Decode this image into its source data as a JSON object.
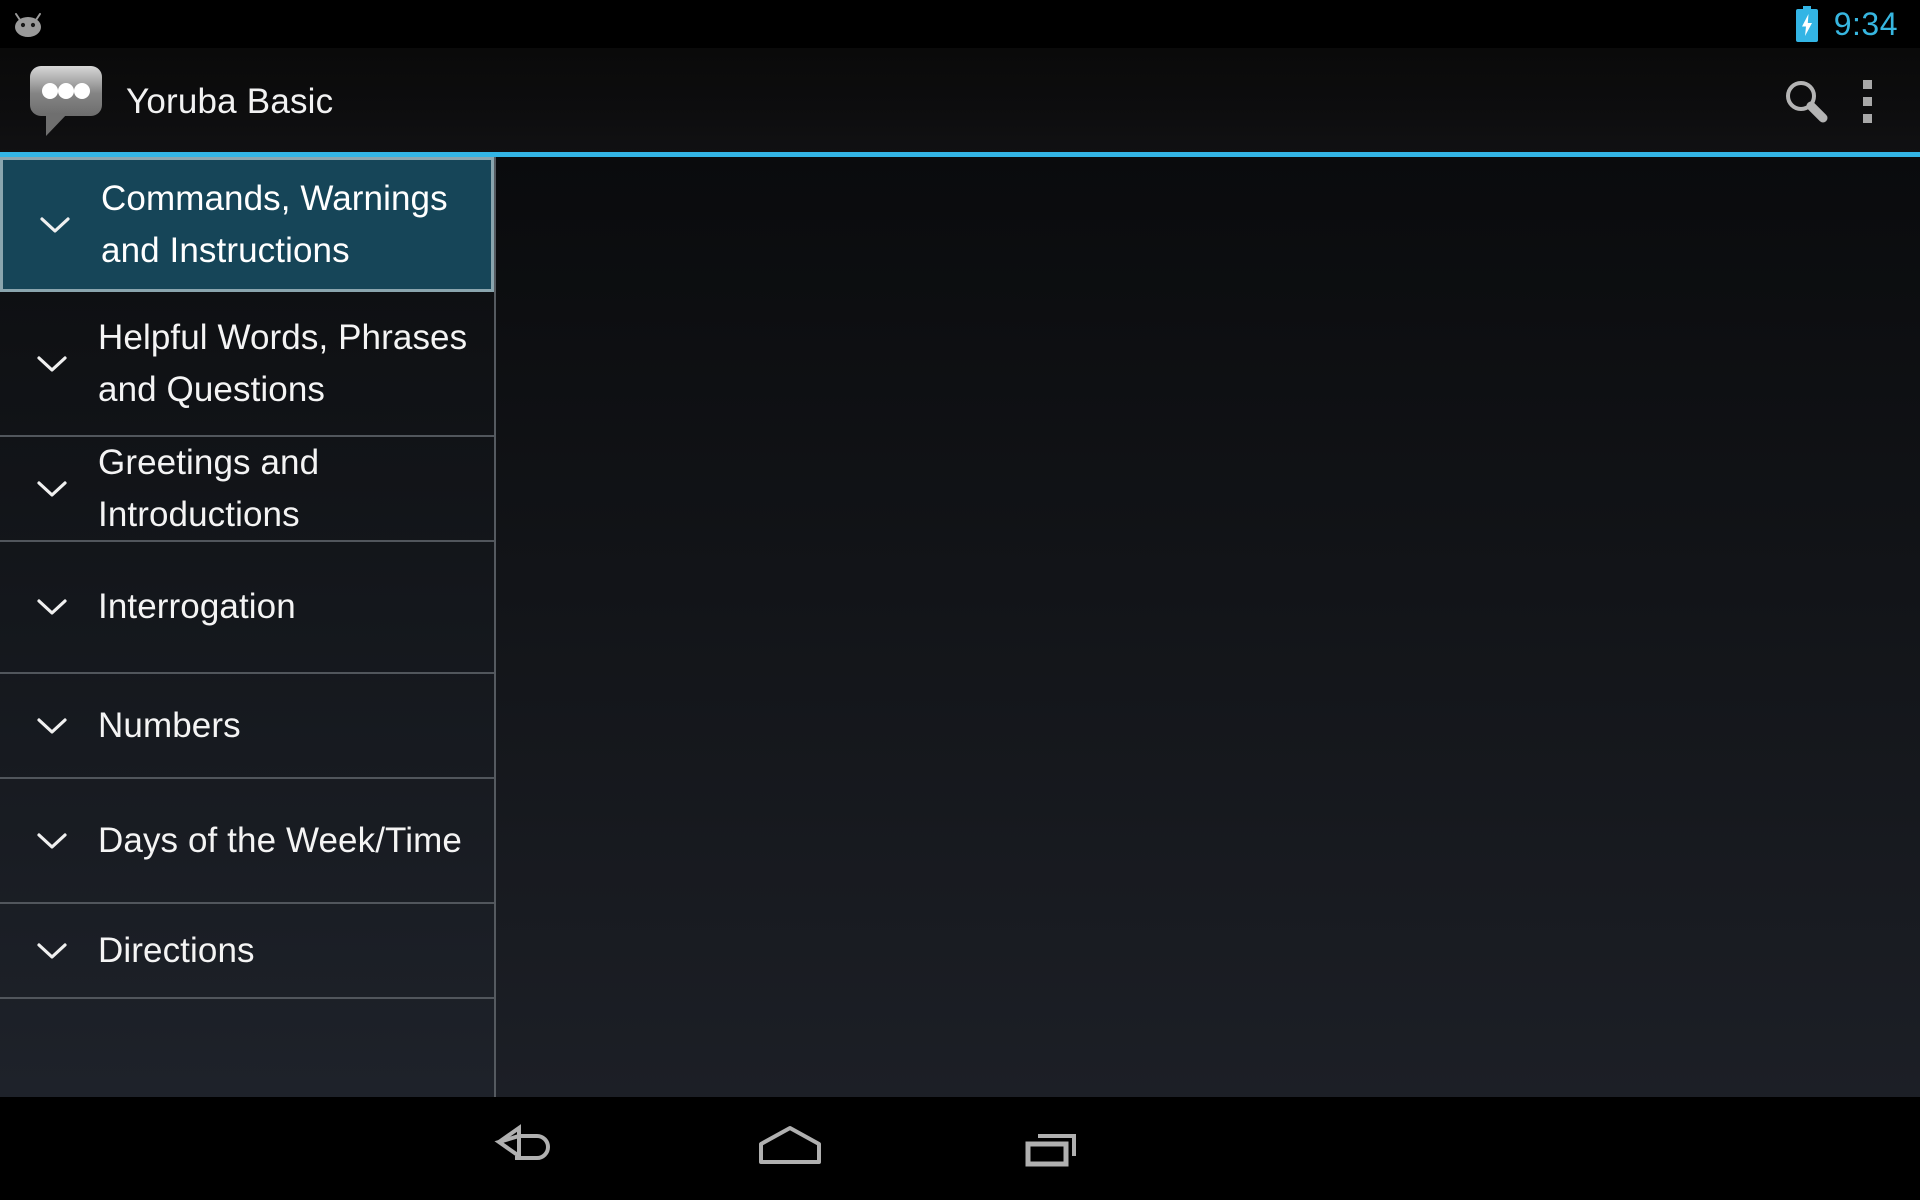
{
  "status_bar": {
    "os_icon": "android-bean-icon",
    "battery_icon": "battery-charging-icon",
    "time": "9:34",
    "time_color": "#37b6e0"
  },
  "action_bar": {
    "app_icon": "speech-bubble-icon",
    "title": "Yoruba Basic",
    "search_icon": "search-icon",
    "overflow_icon": "overflow-menu-icon",
    "accent_color": "#33b5e5"
  },
  "sidebar": {
    "selected_index": 0,
    "selected_bg": "#164558",
    "selected_border": "#8aa5ae",
    "items": [
      {
        "label": "Commands, Warnings and Instructions",
        "expand_icon": "chevron-down-icon",
        "selected": true
      },
      {
        "label": "Helpful Words, Phrases and Questions",
        "expand_icon": "chevron-down-icon",
        "selected": false
      },
      {
        "label": "Greetings and Introductions",
        "expand_icon": "chevron-down-icon",
        "selected": false
      },
      {
        "label": "Interrogation",
        "expand_icon": "chevron-down-icon",
        "selected": false
      },
      {
        "label": "Numbers",
        "expand_icon": "chevron-down-icon",
        "selected": false
      },
      {
        "label": "Days of the Week/Time",
        "expand_icon": "chevron-down-icon",
        "selected": false
      },
      {
        "label": "Directions",
        "expand_icon": "chevron-down-icon",
        "selected": false
      }
    ]
  },
  "detail_pane": {
    "content": ""
  },
  "nav_bar": {
    "back_icon": "back-arrow-icon",
    "home_icon": "home-icon",
    "recents_icon": "recents-icon"
  }
}
